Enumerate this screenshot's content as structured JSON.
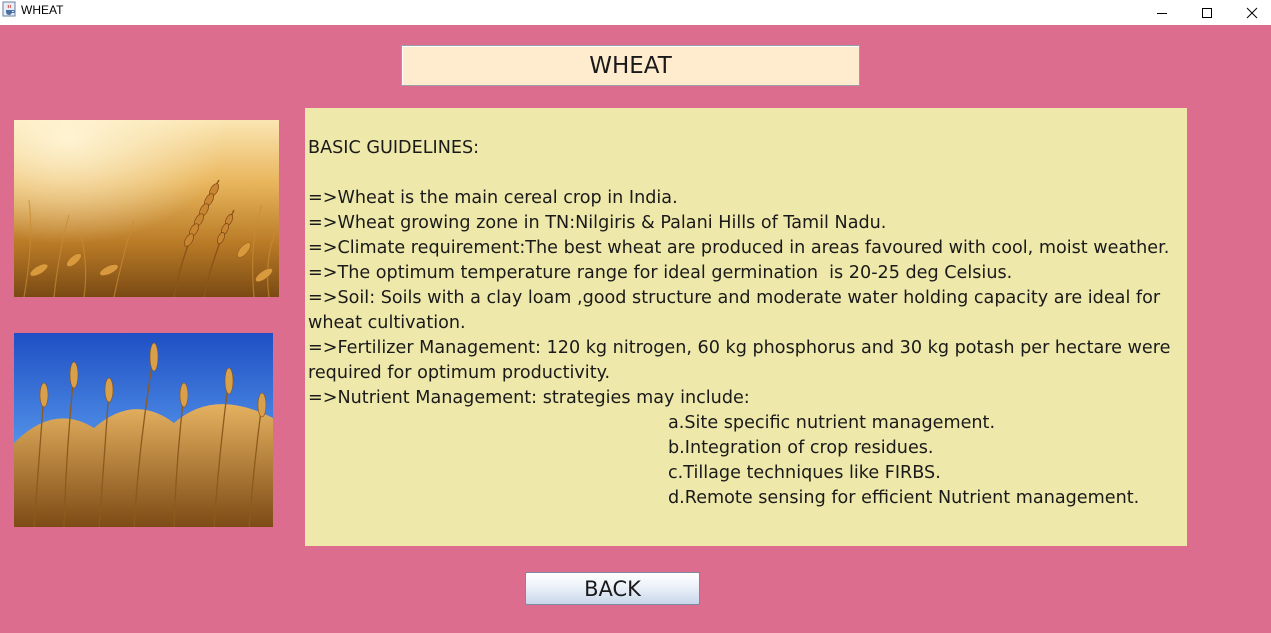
{
  "window": {
    "title": "WHEAT",
    "icon": "java-cup-icon",
    "controls": [
      "minimize-icon",
      "maximize-icon",
      "close-icon"
    ]
  },
  "heading": {
    "text": "WHEAT"
  },
  "images": [
    {
      "name": "golden-wheat-field-image"
    },
    {
      "name": "wheat-under-blue-sky-image"
    }
  ],
  "info": {
    "lines": [
      "BASIC GUIDELINES:",
      "",
      "=>Wheat is the main cereal crop in India.",
      "=>Wheat growing zone in TN:Nilgiris & Palani Hills of Tamil Nadu.",
      "=>Climate requirement:The best wheat are produced in areas favoured with cool, moist weather.",
      "=>The optimum temperature range for ideal germination  is 20-25 deg Celsius.",
      "=>Soil: Soils with a clay loam ,good structure and moderate water holding capacity are ideal for",
      "wheat cultivation.",
      "=>Fertilizer Management: 120 kg nitrogen, 60 kg phosphorus and 30 kg potash per hectare were",
      "required for optimum productivity.",
      "=>Nutrient Management: strategies may include:",
      "a.Site specific nutrient management.",
      "b.Integration of crop residues.",
      "c.Tillage techniques like FIRBS.",
      "d.Remote sensing for efficient Nutrient management."
    ]
  },
  "back_button": {
    "label": "BACK"
  },
  "colors": {
    "background": "#dc6d8f",
    "heading_bg": "#ffebcd",
    "info_bg": "#eee8aa"
  }
}
